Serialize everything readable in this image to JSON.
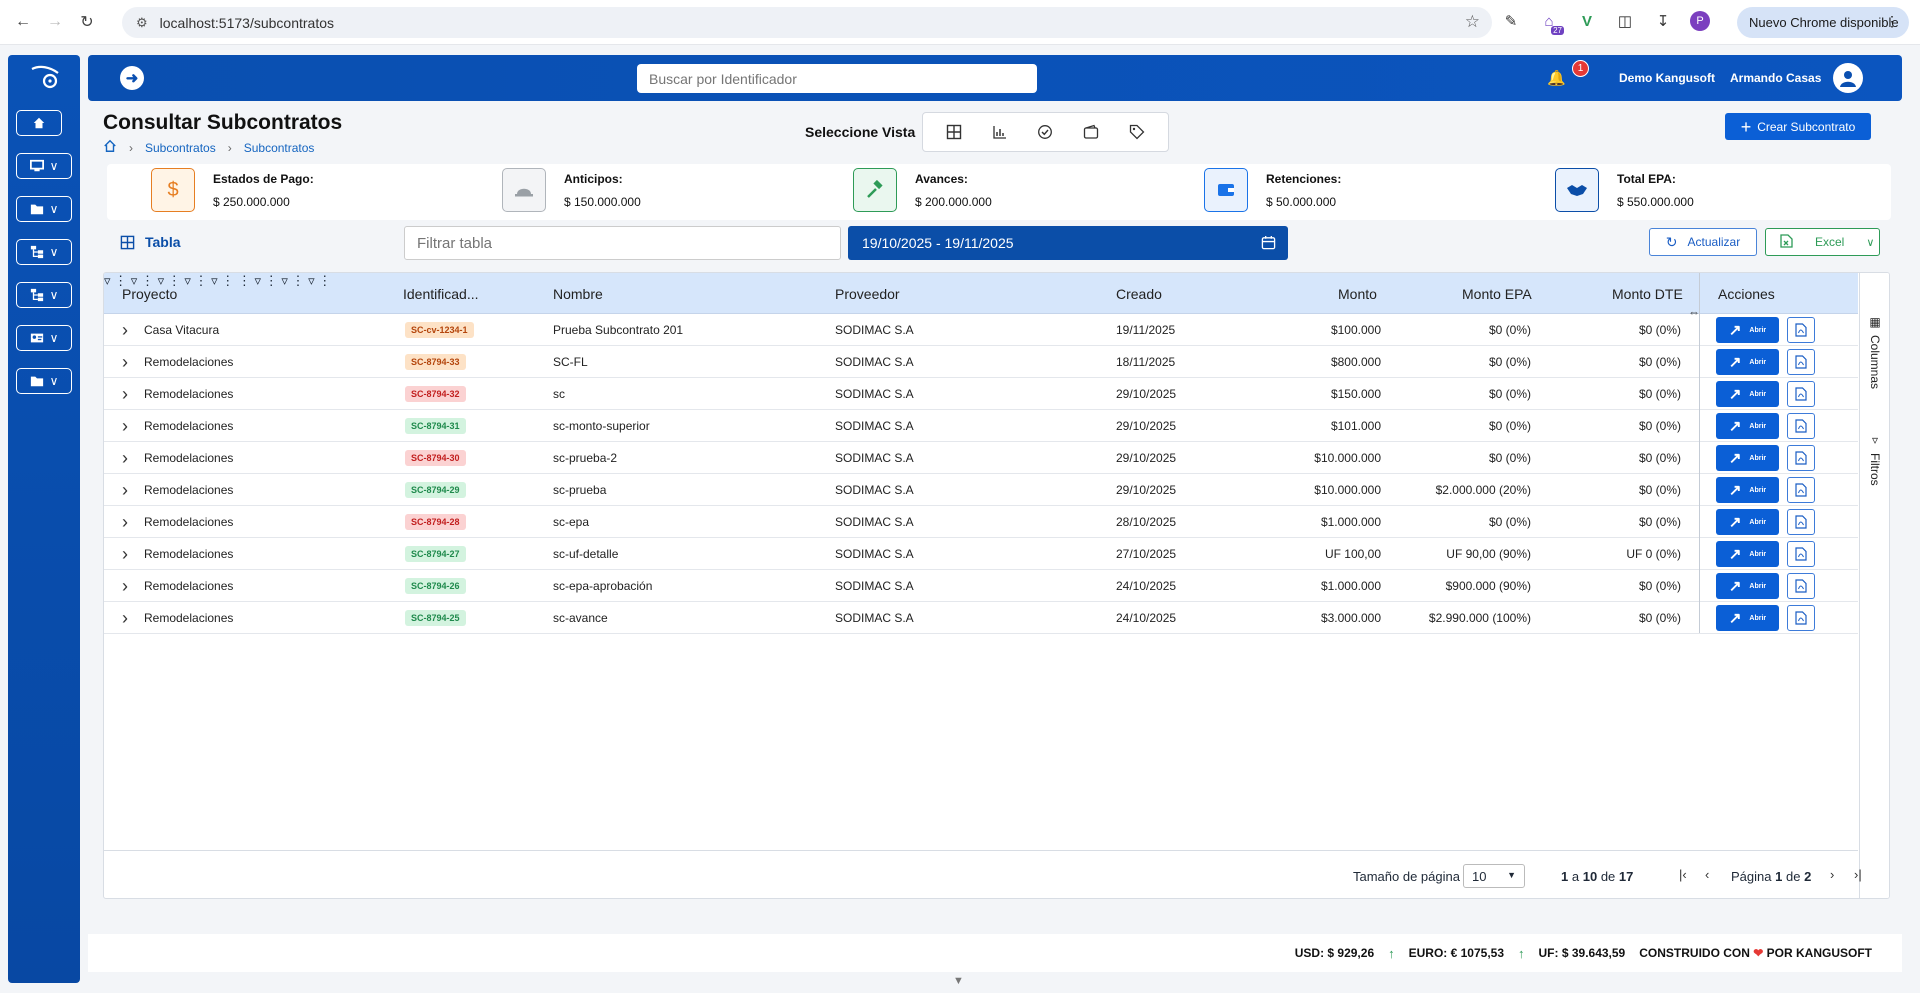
{
  "browser": {
    "url": "localhost:5173/subcontratos",
    "update_label": "Nuevo Chrome disponible",
    "ext_badge": "27",
    "profile_initial": "P"
  },
  "appbar": {
    "search_placeholder": "Buscar por Identificador",
    "notif_count": "1",
    "company": "Demo Kangusoft",
    "user": "Armando Casas"
  },
  "page": {
    "title": "Consultar Subcontratos",
    "breadcrumb": [
      "Subcontratos",
      "Subcontratos"
    ],
    "view_label": "Seleccione Vista",
    "create_label": "Crear Subcontrato"
  },
  "summary": [
    {
      "label": "Estados de Pago:",
      "value": "$ 250.000.000",
      "icon": "dollar-icon",
      "color": "#e67e22"
    },
    {
      "label": "Anticipos:",
      "value": "$ 150.000.000",
      "icon": "helmet-icon",
      "color": "#9aa0a6"
    },
    {
      "label": "Avances:",
      "value": "$ 200.000.000",
      "icon": "hammer-icon",
      "color": "#2e9b57"
    },
    {
      "label": "Retenciones:",
      "value": "$ 50.000.000",
      "icon": "wallet-icon",
      "color": "#1a73e8"
    },
    {
      "label": "Total EPA:",
      "value": "$ 550.000.000",
      "icon": "handshake-icon",
      "color": "#0b4ea8"
    }
  ],
  "toolbar": {
    "tab_label": "Tabla",
    "filter_placeholder": "Filtrar tabla",
    "date_range": "19/10/2025 - 19/11/2025",
    "update_label": "Actualizar",
    "excel_label": "Excel"
  },
  "grid": {
    "columns": [
      "Proyecto",
      "Identificad...",
      "Nombre",
      "Proveedor",
      "Creado",
      "Monto",
      "Monto EPA",
      "Monto DTE",
      "Acciones"
    ],
    "open_label": "Abrir",
    "rows": [
      {
        "proyecto": "Casa Vitacura",
        "id": "SC-cv-1234-1",
        "status": "orange",
        "nombre": "Prueba Subcontrato 201",
        "proveedor": "SODIMAC S.A",
        "creado": "19/11/2025",
        "monto": "$100.000",
        "epa": "$0 (0%)",
        "dte": "$0 (0%)"
      },
      {
        "proyecto": "Remodelaciones",
        "id": "SC-8794-33",
        "status": "orange",
        "nombre": "SC-FL",
        "proveedor": "SODIMAC S.A",
        "creado": "18/11/2025",
        "monto": "$800.000",
        "epa": "$0 (0%)",
        "dte": "$0 (0%)"
      },
      {
        "proyecto": "Remodelaciones",
        "id": "SC-8794-32",
        "status": "red",
        "nombre": "sc",
        "proveedor": "SODIMAC S.A",
        "creado": "29/10/2025",
        "monto": "$150.000",
        "epa": "$0 (0%)",
        "dte": "$0 (0%)"
      },
      {
        "proyecto": "Remodelaciones",
        "id": "SC-8794-31",
        "status": "green",
        "nombre": "sc-monto-superior",
        "proveedor": "SODIMAC S.A",
        "creado": "29/10/2025",
        "monto": "$101.000",
        "epa": "$0 (0%)",
        "dte": "$0 (0%)"
      },
      {
        "proyecto": "Remodelaciones",
        "id": "SC-8794-30",
        "status": "red",
        "nombre": "sc-prueba-2",
        "proveedor": "SODIMAC S.A",
        "creado": "29/10/2025",
        "monto": "$10.000.000",
        "epa": "$0 (0%)",
        "dte": "$0 (0%)"
      },
      {
        "proyecto": "Remodelaciones",
        "id": "SC-8794-29",
        "status": "green",
        "nombre": "sc-prueba",
        "proveedor": "SODIMAC S.A",
        "creado": "29/10/2025",
        "monto": "$10.000.000",
        "epa": "$2.000.000 (20%)",
        "dte": "$0 (0%)"
      },
      {
        "proyecto": "Remodelaciones",
        "id": "SC-8794-28",
        "status": "red",
        "nombre": "sc-epa",
        "proveedor": "SODIMAC S.A",
        "creado": "28/10/2025",
        "monto": "$1.000.000",
        "epa": "$0 (0%)",
        "dte": "$0 (0%)"
      },
      {
        "proyecto": "Remodelaciones",
        "id": "SC-8794-27",
        "status": "green",
        "nombre": "sc-uf-detalle",
        "proveedor": "SODIMAC S.A",
        "creado": "27/10/2025",
        "monto": "UF 100,00",
        "epa": "UF 90,00 (90%)",
        "dte": "UF 0 (0%)"
      },
      {
        "proyecto": "Remodelaciones",
        "id": "SC-8794-26",
        "status": "green",
        "nombre": "sc-epa-aprobación",
        "proveedor": "SODIMAC S.A",
        "creado": "24/10/2025",
        "monto": "$1.000.000",
        "epa": "$900.000 (90%)",
        "dte": "$0 (0%)"
      },
      {
        "proyecto": "Remodelaciones",
        "id": "SC-8794-25",
        "status": "green",
        "nombre": "sc-avance",
        "proveedor": "SODIMAC S.A",
        "creado": "24/10/2025",
        "monto": "$3.000.000",
        "epa": "$2.990.000 (100%)",
        "dte": "$0 (0%)"
      }
    ],
    "side_columns": "Columnas",
    "side_filters": "Filtros"
  },
  "pager": {
    "size_label": "Tamaño de página",
    "size_value": "10",
    "from": "1",
    "a": "a",
    "to": "10",
    "de": "de",
    "total": "17",
    "page_label": "Página",
    "page": "1",
    "pages": "2"
  },
  "footer": {
    "usd": "USD: $ 929,26",
    "euro": "EURO: € 1075,53",
    "uf": "UF: $ 39.643,59",
    "built_prefix": "CONSTRUIDO CON",
    "built_suffix": "POR KANGUSOFT"
  }
}
